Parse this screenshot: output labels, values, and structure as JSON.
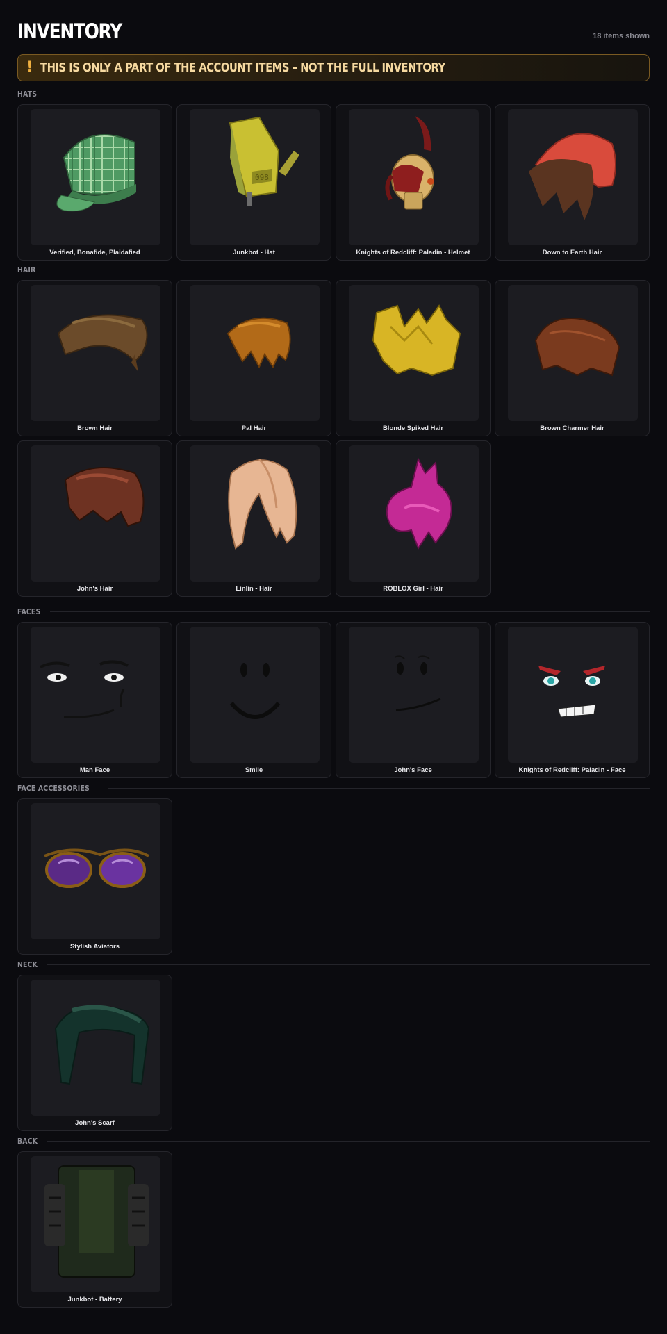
{
  "header": {
    "title": "INVENTORY",
    "count_text": "18 items shown"
  },
  "warning": {
    "icon": "!",
    "text": "THIS IS ONLY A PART OF THE ACCOUNT ITEMS – NOT THE FULL INVENTORY"
  },
  "colors": {
    "background": "#0b0b0f",
    "card": "#111115",
    "thumb": "#1c1c21",
    "warning_border": "#7a5a22",
    "warning_text": "#f6d9a0"
  },
  "sections": [
    {
      "label": "HATS",
      "items": [
        {
          "name": "Verified, Bonafide, Plaidafied",
          "icon": "plaid-cap-icon"
        },
        {
          "name": "Junkbot - Hat",
          "icon": "junkbot-hat-icon"
        },
        {
          "name": "Knights of Redcliff: Paladin - Helmet",
          "icon": "paladin-helmet-icon"
        },
        {
          "name": "Down to Earth Hair",
          "icon": "beanie-hair-icon"
        }
      ]
    },
    {
      "label": "HAIR",
      "items": [
        {
          "name": "Brown Hair",
          "icon": "brown-hair-icon"
        },
        {
          "name": "Pal Hair",
          "icon": "pal-hair-icon"
        },
        {
          "name": "Blonde Spiked Hair",
          "icon": "blonde-spiked-hair-icon"
        },
        {
          "name": "Brown Charmer Hair",
          "icon": "charmer-hair-icon"
        },
        {
          "name": "John's Hair",
          "icon": "johns-hair-icon"
        },
        {
          "name": "Linlin - Hair",
          "icon": "linlin-hair-icon"
        },
        {
          "name": "ROBLOX Girl - Hair",
          "icon": "pink-hair-icon"
        }
      ]
    },
    {
      "label": "FACES",
      "items": [
        {
          "name": "Man Face",
          "icon": "man-face-icon"
        },
        {
          "name": "Smile",
          "icon": "smile-face-icon"
        },
        {
          "name": "John's Face",
          "icon": "johns-face-icon"
        },
        {
          "name": "Knights of Redcliff: Paladin - Face",
          "icon": "paladin-face-icon"
        }
      ]
    },
    {
      "label": "FACE ACCESSORIES",
      "items": [
        {
          "name": "Stylish Aviators",
          "icon": "aviators-icon"
        }
      ]
    },
    {
      "label": "NECK",
      "items": [
        {
          "name": "John's Scarf",
          "icon": "scarf-icon"
        }
      ]
    },
    {
      "label": "BACK",
      "items": [
        {
          "name": "Junkbot - Battery",
          "icon": "battery-icon"
        }
      ]
    }
  ]
}
